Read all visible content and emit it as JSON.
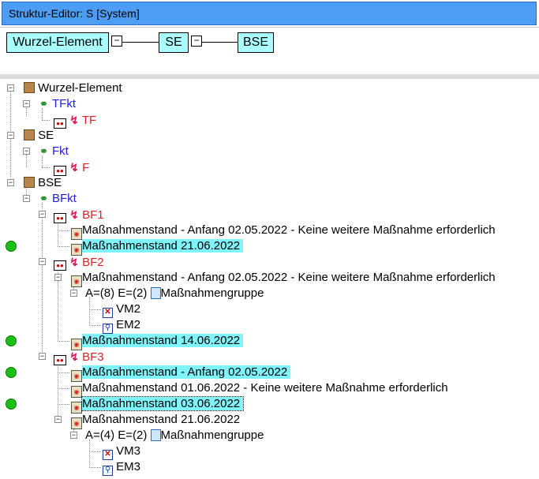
{
  "window": {
    "title": "Struktur-Editor: S [System]"
  },
  "header": {
    "boxes": [
      "Wurzel-Element",
      "SE",
      "BSE"
    ],
    "collapse_glyph": "−"
  },
  "tree": {
    "root1": {
      "label": "Wurzel-Element",
      "fkt": "TFkt",
      "f": "TF"
    },
    "root2": {
      "label": "SE",
      "fkt": "Fkt",
      "f": "F"
    },
    "root3": {
      "label": "BSE",
      "fkt": "BFkt",
      "bf1": {
        "label": "BF1",
        "m1": "Maßnahmenstand - Anfang 02.05.2022 - Keine weitere Maßnahme erforderlich",
        "m2": "Maßnahmenstand 21.06.2022"
      },
      "bf2": {
        "label": "BF2",
        "m1": "Maßnahmenstand - Anfang 02.05.2022 - Keine weitere Maßnahme erforderlich",
        "group": "A=(8) E=(2)",
        "group_label": "Maßnahmengruppe",
        "vm": "VM2",
        "em": "EM2",
        "m2": "Maßnahmenstand 14.06.2022"
      },
      "bf3": {
        "label": "BF3",
        "m1": "Maßnahmenstand - Anfang 02.05.2022",
        "m2": "Maßnahmenstand 01.06.2022 - Keine weitere Maßnahme erforderlich",
        "m3": "Maßnahmenstand 03.06.2022",
        "m4": "Maßnahmenstand 21.06.2022",
        "group": "A=(4) E=(2)",
        "group_label": "Maßnahmengruppe",
        "vm": "VM3",
        "em": "EM3"
      }
    },
    "expander": "−"
  },
  "colors": {
    "title_bg": "#4d9df5",
    "box_bg": "#aaffff",
    "highlight": "#7ff5fb",
    "status_dot": "#18c018"
  },
  "icons": {
    "collapse": "minus-icon",
    "element": "element-square-icon",
    "function": "link-icon",
    "fault": "bolt-icon",
    "measure": "document-icon",
    "status": "green-dot-icon"
  }
}
